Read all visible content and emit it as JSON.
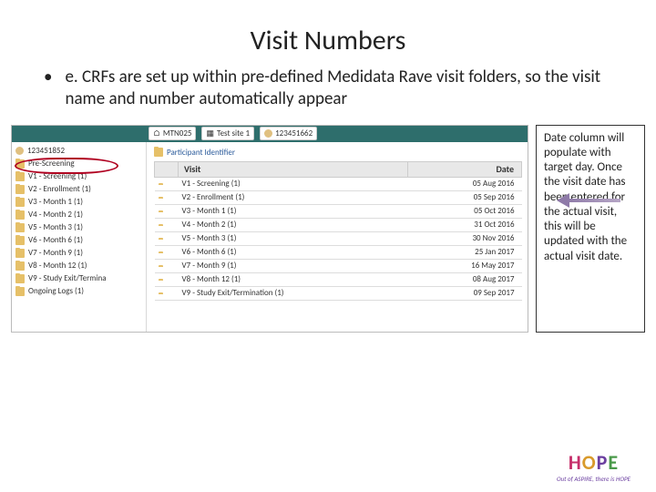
{
  "title": "Visit Numbers",
  "bullet": "e. CRFs are set up within pre-defined Medidata Rave visit folders, so the visit name and number automatically appear",
  "topbar": {
    "study": "MTN025",
    "site": "Test site 1",
    "subject": "123451662"
  },
  "sidebar": {
    "subject": "123451852",
    "items": [
      "Pre-Screening",
      "V1 - Screening (1)",
      "V2 - Enrollment (1)",
      "V3 - Month 1 (1)",
      "V4 - Month 2 (1)",
      "V5 - Month 3 (1)",
      "V6 - Month 6 (1)",
      "V7 - Month 9 (1)",
      "V8 - Month 12 (1)",
      "V9 - Study Exit/Termina",
      "Ongoing Logs (1)"
    ]
  },
  "main_link": "Participant Identifier",
  "grid": {
    "col_visit": "Visit",
    "col_date": "Date",
    "rows": [
      {
        "visit": "V1 - Screening (1)",
        "date": "05 Aug 2016"
      },
      {
        "visit": "V2 - Enrollment (1)",
        "date": "05 Sep 2016"
      },
      {
        "visit": "V3 - Month 1 (1)",
        "date": "05 Oct 2016"
      },
      {
        "visit": "V4 - Month 2 (1)",
        "date": "31 Oct 2016"
      },
      {
        "visit": "V5 - Month 3 (1)",
        "date": "30 Nov 2016"
      },
      {
        "visit": "V6 - Month 6 (1)",
        "date": "25 Jan 2017"
      },
      {
        "visit": "V7 - Month 9 (1)",
        "date": "16 May 2017"
      },
      {
        "visit": "V8 - Month 12 (1)",
        "date": "08 Aug 2017"
      },
      {
        "visit": "V9 - Study Exit/Termination (1)",
        "date": "09 Sep 2017"
      }
    ]
  },
  "note": "Date column will populate with target day. Once the visit date has been entered for the actual visit, this will be updated with the actual visit date.",
  "logo": {
    "brand": "HOPE",
    "tag": "Out of ASPIRE, there is HOPE"
  }
}
